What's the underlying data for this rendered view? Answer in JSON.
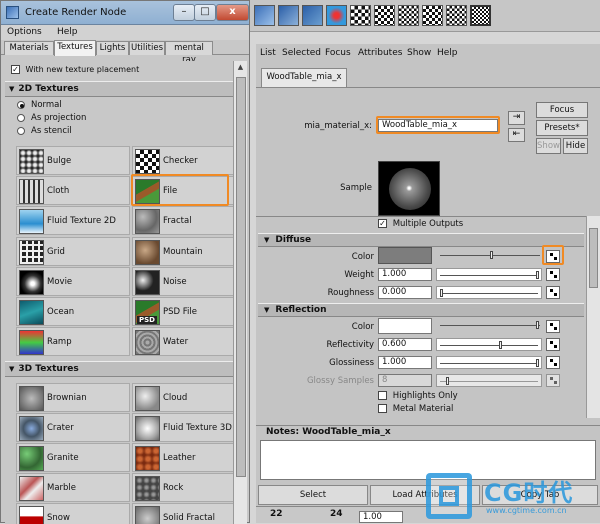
{
  "window": {
    "title": "Create Render Node",
    "controls": {
      "minimize": "–",
      "maximize": "□",
      "close": "x"
    }
  },
  "menu": [
    "Options",
    "Help"
  ],
  "tabs": [
    "Materials",
    "Textures",
    "Lights",
    "Utilities",
    "mental ray"
  ],
  "active_tab": "Textures",
  "texture_placement_checkbox": {
    "label": "With new texture placement",
    "checked": true
  },
  "section_2d": "2D Textures",
  "placement_modes": [
    {
      "label": "Normal",
      "selected": true
    },
    {
      "label": "As projection",
      "selected": false
    },
    {
      "label": "As stencil",
      "selected": false
    }
  ],
  "textures_2d": [
    {
      "label": "Bulge",
      "icon": "bulge-icon"
    },
    {
      "label": "Checker",
      "icon": "checker-icon"
    },
    {
      "label": "Cloth",
      "icon": "cloth-icon"
    },
    {
      "label": "File",
      "icon": "file-icon"
    },
    {
      "label": "Fluid Texture 2D",
      "icon": "fluid-texture-2d-icon"
    },
    {
      "label": "Fractal",
      "icon": "fractal-icon"
    },
    {
      "label": "Grid",
      "icon": "grid-icon"
    },
    {
      "label": "Mountain",
      "icon": "mountain-icon"
    },
    {
      "label": "Movie",
      "icon": "movie-icon"
    },
    {
      "label": "Noise",
      "icon": "noise-icon"
    },
    {
      "label": "Ocean",
      "icon": "ocean-icon"
    },
    {
      "label": "PSD File",
      "icon": "psd-file-icon",
      "badge": "PSD"
    },
    {
      "label": "Ramp",
      "icon": "ramp-icon"
    },
    {
      "label": "Water",
      "icon": "water-icon"
    }
  ],
  "section_3d": "3D Textures",
  "textures_3d": [
    {
      "label": "Brownian",
      "icon": "brownian-icon"
    },
    {
      "label": "Cloud",
      "icon": "cloud-icon"
    },
    {
      "label": "Crater",
      "icon": "crater-icon"
    },
    {
      "label": "Fluid Texture 3D",
      "icon": "fluid-texture-3d-icon"
    },
    {
      "label": "Granite",
      "icon": "granite-icon"
    },
    {
      "label": "Leather",
      "icon": "leather-icon"
    },
    {
      "label": "Marble",
      "icon": "marble-icon"
    },
    {
      "label": "Rock",
      "icon": "rock-icon"
    },
    {
      "label": "Snow",
      "icon": "snow-icon"
    },
    {
      "label": "Solid Fractal",
      "icon": "solid-fractal-icon"
    }
  ],
  "attribute_editor": {
    "menu": [
      "List",
      "Selected",
      "Focus",
      "Attributes",
      "Show",
      "Help"
    ],
    "node_tab": "WoodTable_mia_x",
    "material_label": "mia_material_x:",
    "material_value": "WoodTable_mia_x",
    "buttons": {
      "focus": "Focus",
      "presets": "Presets*",
      "show": "Show",
      "hide": "Hide"
    },
    "sample_label": "Sample",
    "multiple_outputs": {
      "label": "Multiple Outputs",
      "checked": true
    },
    "diffuse": {
      "title": "Diffuse",
      "color_label": "Color",
      "weight_label": "Weight",
      "weight_value": "1.000",
      "roughness_label": "Roughness",
      "roughness_value": "0.000"
    },
    "reflection": {
      "title": "Reflection",
      "color_label": "Color",
      "reflectivity_label": "Reflectivity",
      "reflectivity_value": "0.600",
      "glossiness_label": "Glossiness",
      "glossiness_value": "1.000",
      "glossy_samples_label": "Glossy Samples",
      "glossy_samples_value": "8",
      "highlights_only": "Highlights Only",
      "metal_material": "Metal Material"
    },
    "notes_label": "Notes:  WoodTable_mia_x",
    "bottom_buttons": {
      "select": "Select",
      "load_attributes": "Load Attributes",
      "copy_tab": "Copy Tab"
    }
  },
  "timeline": {
    "start": "22",
    "end": "24",
    "value": "1.00"
  },
  "watermark": {
    "brand": "CG时代",
    "url": "www.cgtime.com.cn"
  },
  "colors": {
    "highlight": "#f08a24",
    "diffuse_swatch": "#7d7d7d",
    "reflection_swatch": "#ffffff"
  }
}
